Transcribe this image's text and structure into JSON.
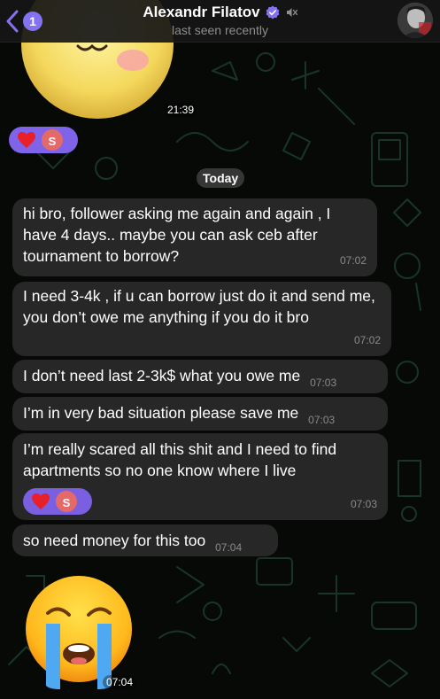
{
  "header": {
    "back_badge": "1",
    "contact_name": "Alexandr Filatov",
    "status": "last seen recently"
  },
  "icons": {
    "back": "chevron-left-icon",
    "verified": "verified-icon",
    "muted": "mute-icon"
  },
  "colors": {
    "accent": "#8473f0",
    "reaction_bg": "#7f63e8",
    "bubble_bg": "#272727",
    "reactor_avatar": "#e46a6a"
  },
  "messages": {
    "sticker_top_time": "21:39",
    "reaction_top": {
      "emoji": "heart-icon",
      "reactor_initial": "S"
    },
    "date_separator": "Today",
    "items": [
      {
        "text": "hi bro, follower asking me again and again , I have 4 days.. maybe you can ask ceb after tournament to borrow?",
        "time": "07:02"
      },
      {
        "text": "I need 3-4k , if u can borrow just do it and send me, you don’t owe me anything if you do it bro",
        "time": "07:02"
      },
      {
        "text": "I don’t need last 2-3k$ what you owe me",
        "time": "07:03"
      },
      {
        "text": "I’m in very bad situation please save me",
        "time": "07:03"
      },
      {
        "text": "I’m really scared all this shit and I need to find apartments so no one know where I live",
        "time": "07:03",
        "reaction": {
          "emoji": "heart-icon",
          "reactor_initial": "S"
        }
      },
      {
        "text": "so need money for this too",
        "time": "07:04"
      }
    ],
    "sticker_bottom_time": "07:04"
  }
}
